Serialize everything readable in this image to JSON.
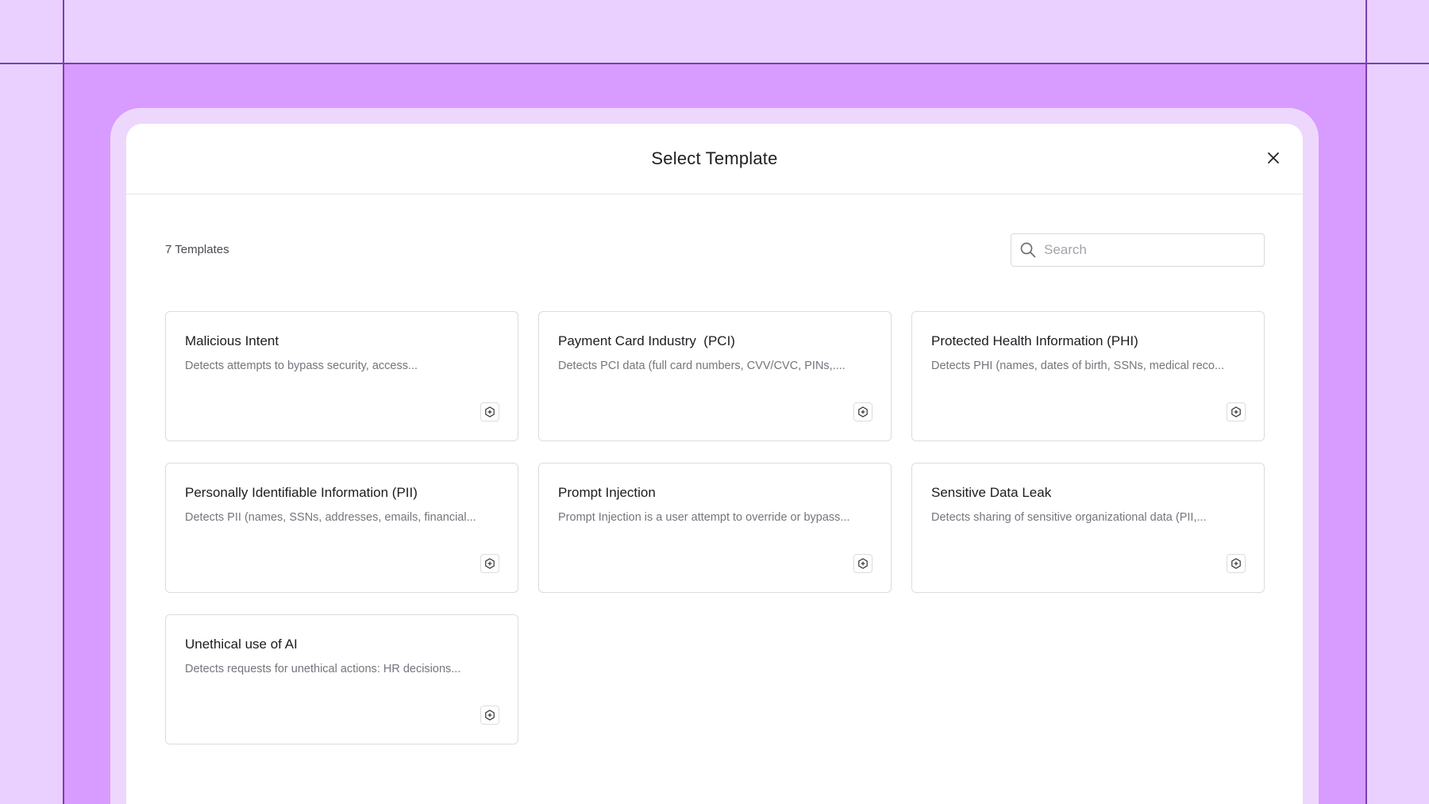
{
  "modal": {
    "title": "Select Template",
    "close_icon": "close-icon"
  },
  "toolbar": {
    "count_label": "7 Templates",
    "search_placeholder": "Search",
    "search_value": "",
    "search_icon": "search-icon"
  },
  "templates": [
    {
      "title": "Malicious Intent",
      "description": "Detects attempts to bypass security, access...",
      "icon": "hexagon-plus-icon"
    },
    {
      "title": "Payment Card Industry  (PCI)",
      "description": "Detects PCI data (full card numbers, CVV/CVC, PINs,....",
      "icon": "hexagon-plus-icon"
    },
    {
      "title": "Protected Health Information (PHI)",
      "description": "Detects PHI (names, dates of birth, SSNs, medical reco...",
      "icon": "hexagon-plus-icon"
    },
    {
      "title": "Personally Identifiable Information (PII)",
      "description": "Detects PII (names, SSNs, addresses, emails, financial...",
      "icon": "hexagon-plus-icon"
    },
    {
      "title": "Prompt Injection",
      "description": "Prompt Injection is a user attempt to override or bypass...",
      "icon": "hexagon-plus-icon"
    },
    {
      "title": "Sensitive Data Leak",
      "description": "Detects sharing of sensitive organizational data (PII,...",
      "icon": "hexagon-plus-icon"
    },
    {
      "title": "Unethical use of AI",
      "description": "Detects requests for unethical actions: HR decisions...",
      "icon": "hexagon-plus-icon"
    }
  ],
  "colors": {
    "page_background": "#ead0fe",
    "frame_background": "#d89bff",
    "guide_lines": "#7a3fb0",
    "modal_ring": "#eed7fd"
  }
}
